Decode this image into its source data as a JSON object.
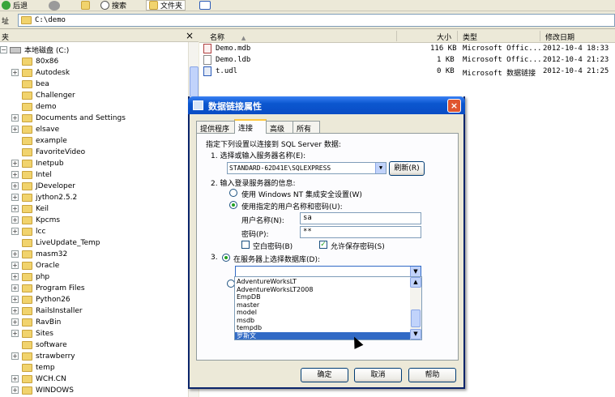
{
  "toolbar": {
    "back_label": "后退",
    "search_label": "搜索",
    "folders_label": "文件夹"
  },
  "address": {
    "label": "址",
    "path": "C:\\demo"
  },
  "left_pane": {
    "title": "夹",
    "close": "×",
    "root": "本地磁盘 (C:)",
    "items": [
      {
        "label": "80x86",
        "expander": ""
      },
      {
        "label": "Autodesk",
        "expander": "+"
      },
      {
        "label": "bea",
        "expander": ""
      },
      {
        "label": "Challenger",
        "expander": ""
      },
      {
        "label": "demo",
        "expander": ""
      },
      {
        "label": "Documents and Settings",
        "expander": "+"
      },
      {
        "label": "elsave",
        "expander": "+"
      },
      {
        "label": "example",
        "expander": ""
      },
      {
        "label": "FavoriteVideo",
        "expander": ""
      },
      {
        "label": "Inetpub",
        "expander": "+"
      },
      {
        "label": "Intel",
        "expander": "+"
      },
      {
        "label": "JDeveloper",
        "expander": "+"
      },
      {
        "label": "jython2.5.2",
        "expander": "+"
      },
      {
        "label": "Keil",
        "expander": "+"
      },
      {
        "label": "Kpcms",
        "expander": "+"
      },
      {
        "label": "lcc",
        "expander": "+"
      },
      {
        "label": "LiveUpdate_Temp",
        "expander": ""
      },
      {
        "label": "masm32",
        "expander": "+"
      },
      {
        "label": "Oracle",
        "expander": "+"
      },
      {
        "label": "php",
        "expander": "+"
      },
      {
        "label": "Program Files",
        "expander": "+"
      },
      {
        "label": "Python26",
        "expander": "+"
      },
      {
        "label": "RailsInstaller",
        "expander": "+"
      },
      {
        "label": "RavBin",
        "expander": "+"
      },
      {
        "label": "Sites",
        "expander": "+"
      },
      {
        "label": "software",
        "expander": ""
      },
      {
        "label": "strawberry",
        "expander": "+"
      },
      {
        "label": "temp",
        "expander": ""
      },
      {
        "label": "WCH.CN",
        "expander": "+"
      },
      {
        "label": "WINDOWS",
        "expander": "+"
      }
    ]
  },
  "file_list": {
    "columns": {
      "name": "名称",
      "size": "大小",
      "type": "类型",
      "modified": "修改日期"
    },
    "sort_arrow": "▲",
    "rows": [
      {
        "name": "Demo.mdb",
        "size": "116 KB",
        "type": "Microsoft Offic...",
        "modified": "2012-10-4 18:33",
        "icon": "access-db-icon"
      },
      {
        "name": "Demo.ldb",
        "size": "1 KB",
        "type": "Microsoft Offic...",
        "modified": "2012-10-4 21:23",
        "icon": "lock-file-icon"
      },
      {
        "name": "t.udl",
        "size": "0 KB",
        "type": "Microsoft 数据链接",
        "modified": "2012-10-4 21:25",
        "icon": "udl-file-icon"
      }
    ]
  },
  "dialog": {
    "title": "数据链接属性",
    "close": "×",
    "tabs": [
      "提供程序",
      "连接",
      "高级",
      "所有"
    ],
    "active_tab": "连接",
    "intro": "指定下列设置以连接到 SQL Server 数据:",
    "step1_label": "1. 选择或输入服务器名称(E):",
    "server_value": "STANDARD-62D41E\\SQLEXPRESS",
    "refresh_label": "刷新(R)",
    "step2_label": "2. 输入登录服务器的信息:",
    "radio_nt_label": "使用 Windows NT 集成安全设置(W)",
    "radio_user_label": "使用指定的用户名称和密码(U):",
    "username_label": "用户名称(N):",
    "username_value": "sa",
    "password_label": "密码(P):",
    "password_value": "**",
    "blank_pw_label": "空白密码(B)",
    "save_pw_label": "允许保存密码(S)",
    "step3_num": "3.",
    "radio_select_db_label": "在服务器上选择数据库(D):",
    "db_combo_value": "",
    "db_options": [
      "AdventureWorksLT",
      "AdventureWorksLT2008",
      "EmpDB",
      "master",
      "model",
      "msdb",
      "tempdb",
      "罗斯文"
    ],
    "db_selected": "罗斯文",
    "ok_label": "确定",
    "cancel_label": "取消",
    "help_label": "帮助"
  },
  "colors": {
    "titlebar": "#0a4cc4",
    "selection": "#316ac5",
    "window_bg": "#ece9d8"
  }
}
